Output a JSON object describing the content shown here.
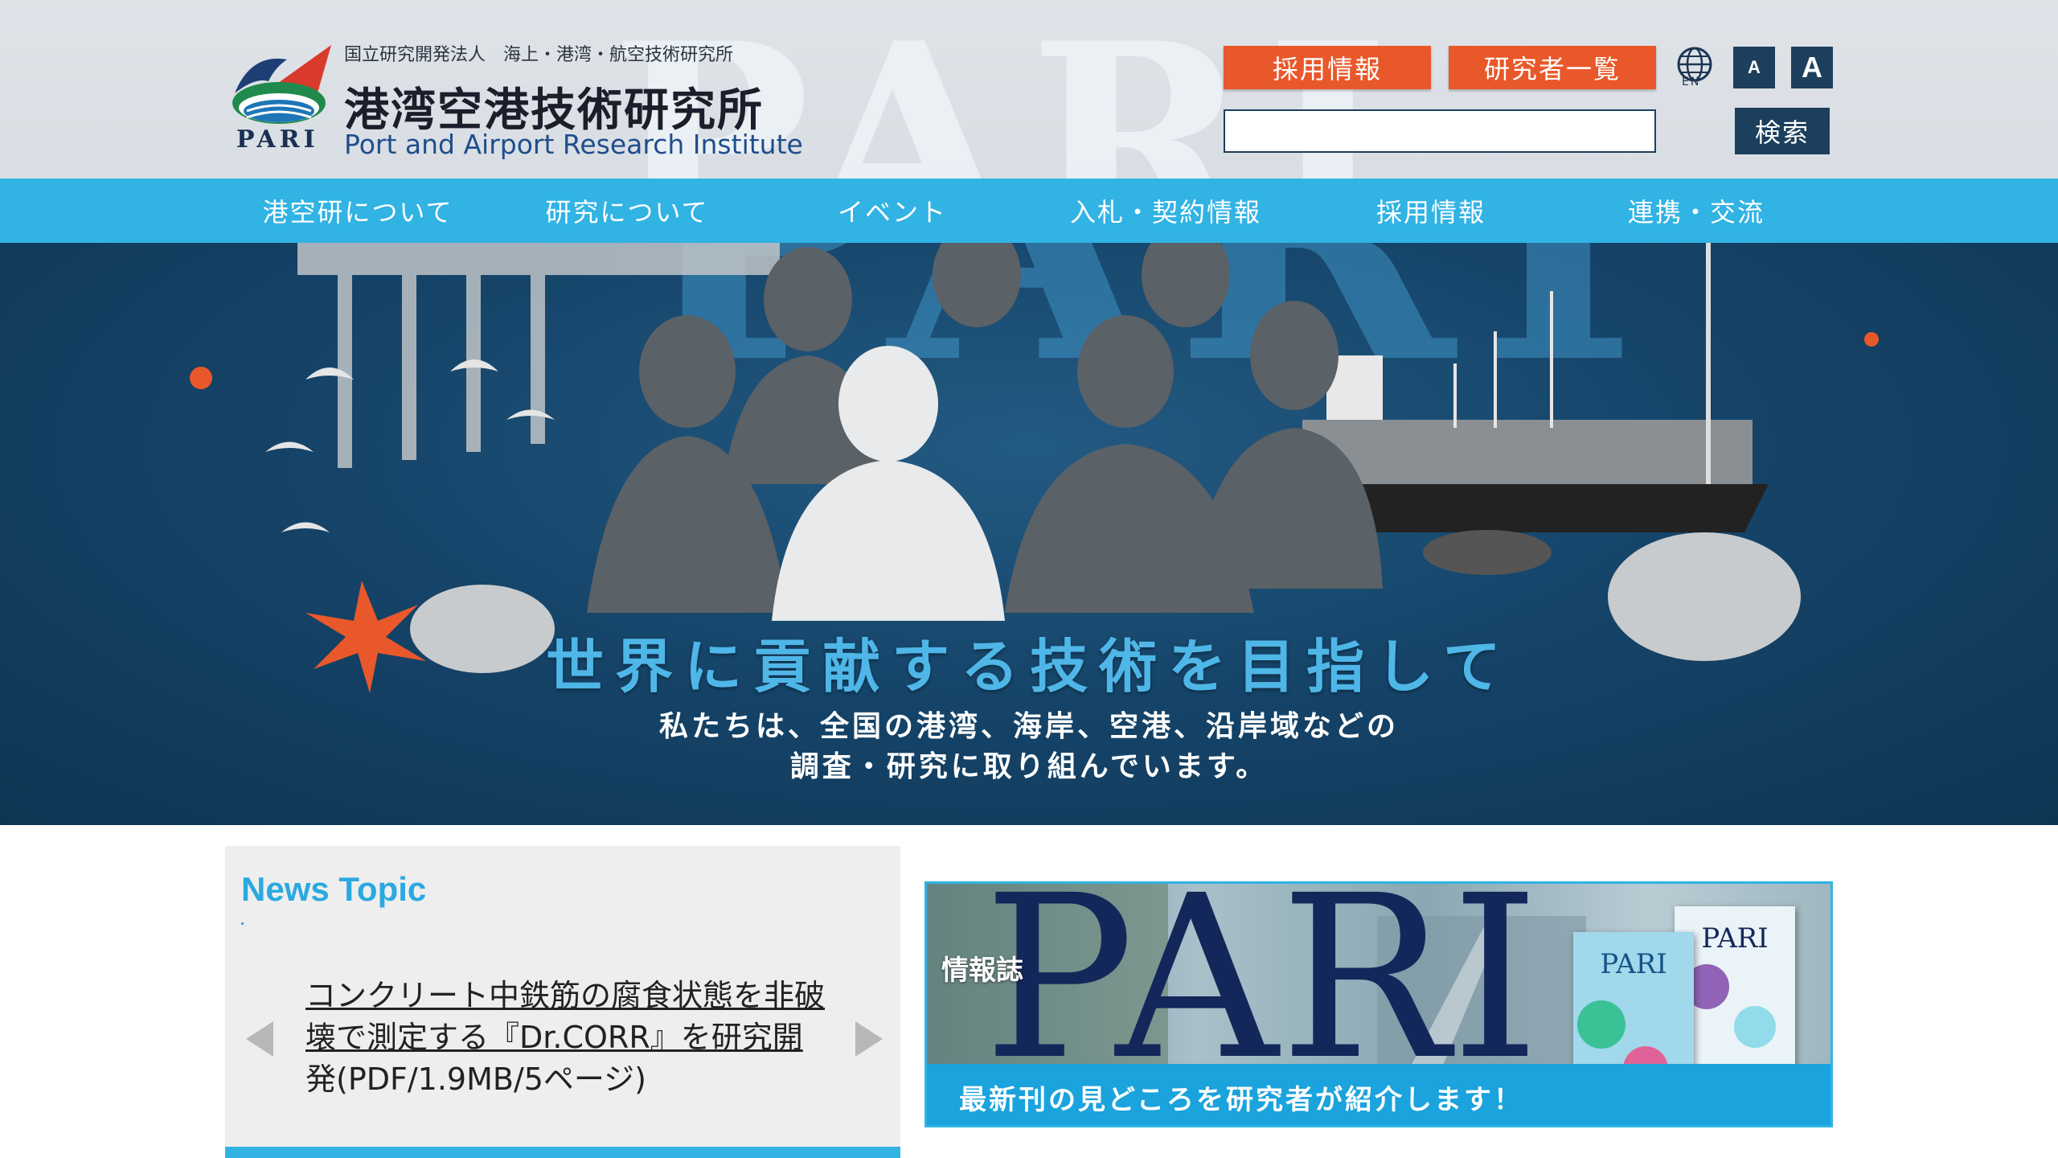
{
  "header": {
    "logo_pari": "PARI",
    "subtitle": "国立研究開発法人　海上・港湾・航空技術研究所",
    "title_jp": "港湾空港技術研究所",
    "title_en": "Port and Airport Research Institute",
    "buttons": {
      "recruit": "採用情報",
      "researchers": "研究者一覧"
    },
    "language_label": "EN",
    "font_size": {
      "small": "A",
      "large": "A"
    },
    "search": {
      "value": "",
      "placeholder": "",
      "button": "検索"
    }
  },
  "nav": {
    "items": [
      {
        "label": "港空研について"
      },
      {
        "label": "研究について"
      },
      {
        "label": "イベント"
      },
      {
        "label": "入札・契約情報"
      },
      {
        "label": "採用情報"
      },
      {
        "label": "連携・交流"
      }
    ]
  },
  "hero": {
    "title": "世界に貢献する技術を目指して",
    "subtitle_line1": "私たちは、全国の港湾、海岸、空港、沿岸域などの",
    "subtitle_line2": "調査・研究に取り組んでいます。"
  },
  "news": {
    "heading": "News Topic",
    "item_link": "コンクリート中鉄筋の腐食状態を非破壊で測定する『Dr.CORR』を研究開",
    "item_suffix": "発(PDF/1.9MB/5ページ)"
  },
  "banner": {
    "label": "情報誌",
    "logo": "PARI",
    "magazine_title": "PARI",
    "caption": "最新刊の見どころを研究者が紹介します！"
  },
  "colors": {
    "accent_blue": "#31b3e4",
    "orange": "#e9582a",
    "navy": "#1d3f5e"
  }
}
